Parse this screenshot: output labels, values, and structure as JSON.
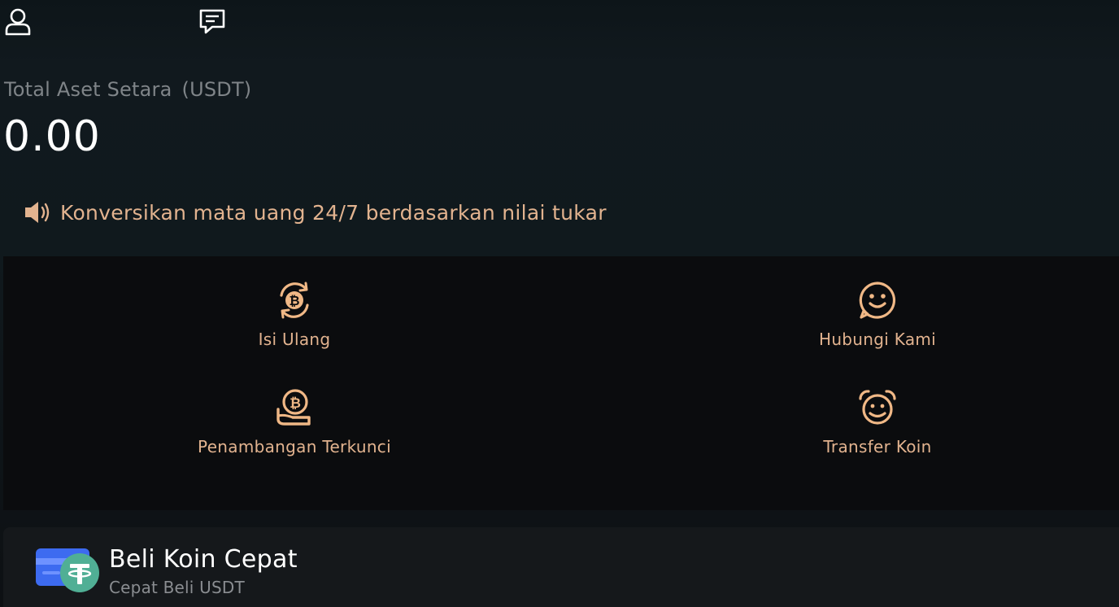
{
  "header": {
    "profile_icon": "user-icon",
    "messages_icon": "message-icon"
  },
  "assets": {
    "label": "Total Aset Setara",
    "unit": "(USDT)",
    "value": "0.00"
  },
  "notice": {
    "icon": "speaker-icon",
    "text": "Konversikan mata uang 24/7 berdasarkan nilai tukar"
  },
  "actions": [
    {
      "label": "Isi Ulang",
      "icon": "bitcoin-recharge-icon"
    },
    {
      "label": "Hubungi Kami",
      "icon": "smiley-chat-icon"
    },
    {
      "label": "Penambangan Terkunci",
      "icon": "bitcoin-hand-icon"
    },
    {
      "label": "Transfer Koin",
      "icon": "alarm-transfer-icon"
    }
  ],
  "quick_buy": {
    "title": "Beli Koin Cepat",
    "subtitle": "Cepat Beli USDT",
    "icon": "card-tether-icon"
  },
  "colors": {
    "accent": "#e2b38f",
    "background": "#10191d",
    "panel": "#0b0c0e",
    "card": "#15181b",
    "tether_green": "#50af95",
    "card_blue": "#3d6bf0"
  }
}
